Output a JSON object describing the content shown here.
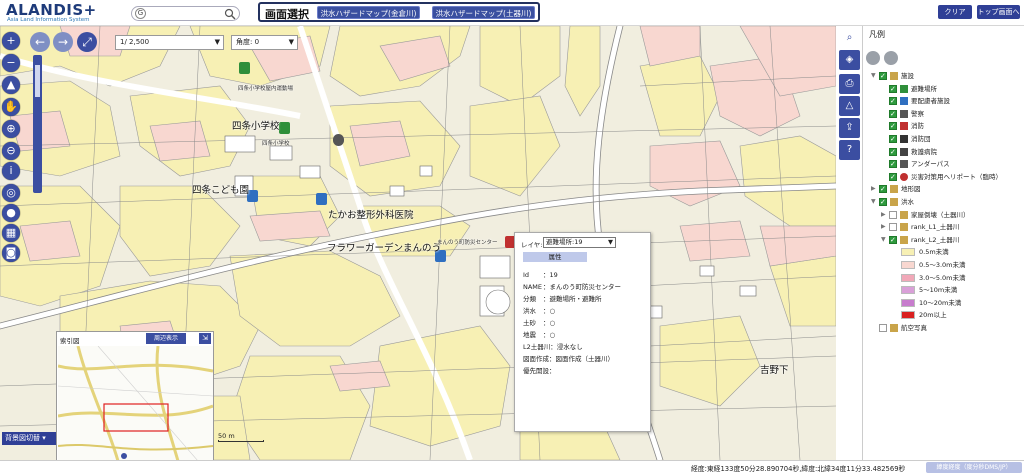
{
  "header": {
    "logo_main": "ALANDIS+",
    "logo_sub": "Asia Land Information System",
    "search_placeholder": "",
    "search_g": "G",
    "screen_select_label": "画面選択",
    "screen_buttons": [
      "洪水ハザードマップ(金倉川)",
      "洪水ハザードマップ(土器川)"
    ],
    "clear_label": "クリア",
    "top_label": "トップ画面へ"
  },
  "map_controls": {
    "scale_value": "1/ 2,500",
    "angle_value": "角度: 0",
    "background_switch": "背景図切替",
    "scalebar_text": "50 m"
  },
  "overview": {
    "title": "索引図",
    "show_button": "周辺表示",
    "close_symbol": "⇲"
  },
  "map_labels": [
    {
      "text": "四条小学校",
      "cls": "ml-big"
    },
    {
      "text": "四条こども園",
      "cls": "ml-big"
    },
    {
      "text": "たかお整形外科医院",
      "cls": "ml-big"
    },
    {
      "text": "フラワーガーデンまんのう",
      "cls": "ml-big"
    },
    {
      "text": "まんのう町防災センター",
      "cls": "ml-small"
    },
    {
      "text": "吉野下",
      "cls": "ml-big"
    },
    {
      "text": "四条小学校屋内運動場",
      "cls": "ml-small"
    },
    {
      "text": "四条小学校",
      "cls": "ml-small"
    }
  ],
  "popup": {
    "layer_label": "レイヤ:",
    "layer_value": "避難場所:19",
    "attr_button": "属性",
    "rows": [
      {
        "k": "Id",
        "v": "：19"
      },
      {
        "k": "NAME",
        "v": "：まんのう町防災センター"
      },
      {
        "k": "分類",
        "v": "：避難場所・避難所"
      },
      {
        "k": "洪水",
        "v": "：○"
      },
      {
        "k": "土砂",
        "v": "：○"
      },
      {
        "k": "地震",
        "v": "：○"
      },
      {
        "k": "L2土器川",
        "v": "：浸水なし"
      },
      {
        "k": "図面作成",
        "v": "：図面作成（土器川）"
      },
      {
        "k": "優先開設",
        "v": "："
      }
    ]
  },
  "legend": {
    "title": "凡例",
    "rows": [
      {
        "indent": 0,
        "tri": "▼",
        "cb": "on",
        "text": "施設",
        "icon": "folder",
        "color": "#c9a44a"
      },
      {
        "indent": 1,
        "tri": "",
        "cb": "on",
        "text": "避難場所",
        "icon": "square",
        "color": "#2f8f3a"
      },
      {
        "indent": 1,
        "tri": "",
        "cb": "on",
        "text": "要配慮者施設",
        "icon": "square",
        "color": "#2f6fc0"
      },
      {
        "indent": 1,
        "tri": "",
        "cb": "on",
        "text": "警察",
        "icon": "square",
        "color": "#555555"
      },
      {
        "indent": 1,
        "tri": "",
        "cb": "on",
        "text": "消防",
        "icon": "square",
        "color": "#c03030"
      },
      {
        "indent": 1,
        "tri": "",
        "cb": "on",
        "text": "消防団",
        "icon": "square",
        "color": "#333333"
      },
      {
        "indent": 1,
        "tri": "",
        "cb": "on",
        "text": "救護病院",
        "icon": "square",
        "color": "#444444"
      },
      {
        "indent": 1,
        "tri": "",
        "cb": "on",
        "text": "アンダーパス",
        "icon": "square",
        "color": "#555555"
      },
      {
        "indent": 1,
        "tri": "",
        "cb": "on",
        "text": "災害対策用ヘリポート（臨時）",
        "icon": "circle",
        "color": "#c03030"
      },
      {
        "indent": 0,
        "tri": "▶",
        "cb": "on",
        "text": "地形図",
        "icon": "folder",
        "color": "#c9a44a"
      },
      {
        "indent": 0,
        "tri": "▼",
        "cb": "on",
        "text": "洪水",
        "icon": "folder",
        "color": "#c9a44a"
      },
      {
        "indent": 1,
        "tri": "▶",
        "cb": "off",
        "text": "家屋倒壊（土器川）",
        "icon": "folder",
        "color": "#c9a44a"
      },
      {
        "indent": 1,
        "tri": "▶",
        "cb": "off",
        "text": "rank_L1_土器川",
        "icon": "folder",
        "color": "#c9a44a"
      },
      {
        "indent": 1,
        "tri": "▼",
        "cb": "on",
        "text": "rank_L2_土器川",
        "icon": "folder",
        "color": "#c9a44a"
      },
      {
        "indent": 2,
        "tri": "",
        "cb": "none",
        "text": "0.5m未満",
        "icon": "swatch",
        "color": "#f7f0b4"
      },
      {
        "indent": 2,
        "tri": "",
        "cb": "none",
        "text": "0.5〜3.0m未満",
        "icon": "swatch",
        "color": "#f8d7d0"
      },
      {
        "indent": 2,
        "tri": "",
        "cb": "none",
        "text": "3.0〜5.0m未満",
        "icon": "swatch",
        "color": "#f1a8b8"
      },
      {
        "indent": 2,
        "tri": "",
        "cb": "none",
        "text": "5〜10m未満",
        "icon": "swatch",
        "color": "#d9a0d8"
      },
      {
        "indent": 2,
        "tri": "",
        "cb": "none",
        "text": "10〜20m未満",
        "icon": "swatch",
        "color": "#c77ccd"
      },
      {
        "indent": 2,
        "tri": "",
        "cb": "none",
        "text": "20m以上",
        "icon": "swatch",
        "color": "#d92020"
      },
      {
        "indent": 0,
        "tri": "",
        "cb": "off",
        "text": "航空写真",
        "icon": "folder",
        "color": "#c9a44a"
      }
    ]
  },
  "status": {
    "coords": "経度:東経133度50分28.890704秒,緯度:北緯34度11分33.482569秒",
    "coord_system": "緯度経度（度分秒DMS/JP）"
  },
  "colors": {
    "accent": "#3b4ea1",
    "flood_yellow": "#f7f0b4",
    "flood_pink": "#f8d7d0"
  }
}
